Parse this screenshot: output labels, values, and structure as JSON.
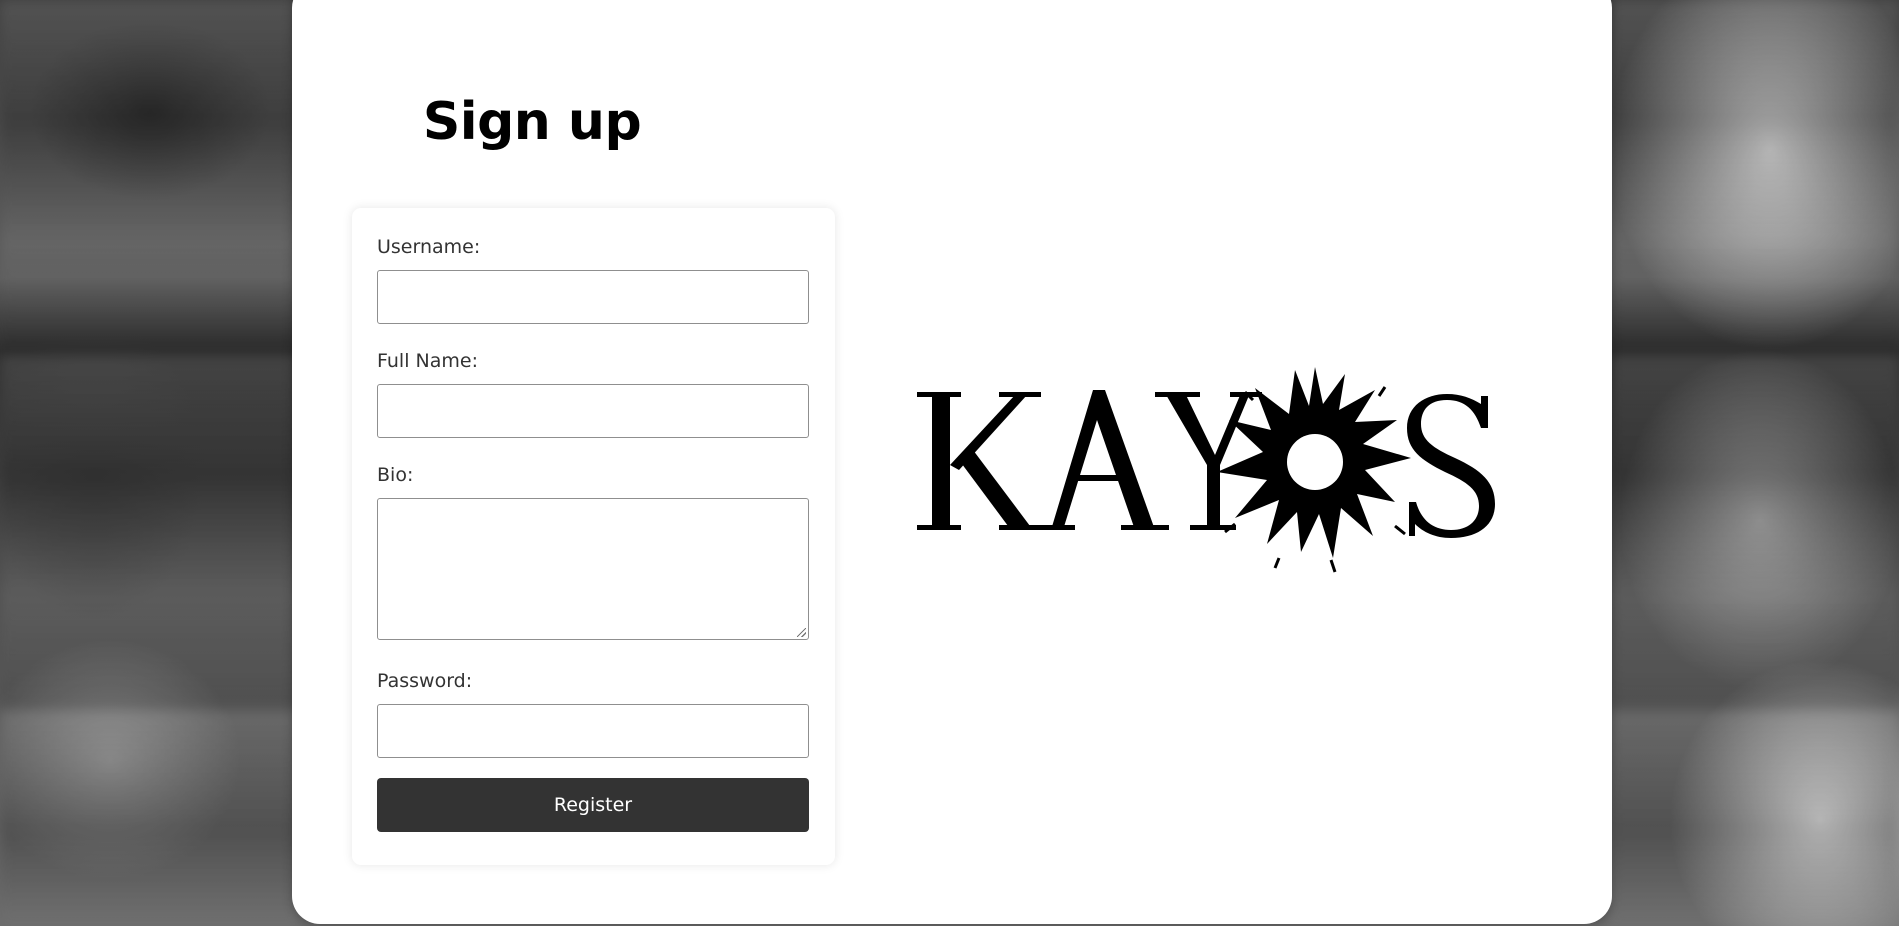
{
  "page": {
    "title": "Sign up"
  },
  "form": {
    "username_label": "Username:",
    "fullname_label": "Full Name:",
    "bio_label": "Bio:",
    "password_label": "Password:",
    "username_value": "",
    "fullname_value": "",
    "bio_value": "",
    "password_value": "",
    "register_label": "Register"
  },
  "brand": {
    "logo_text": "KAYOS",
    "logo_color": "#000000"
  },
  "colors": {
    "button_bg": "#333333",
    "card_bg": "#ffffff"
  }
}
